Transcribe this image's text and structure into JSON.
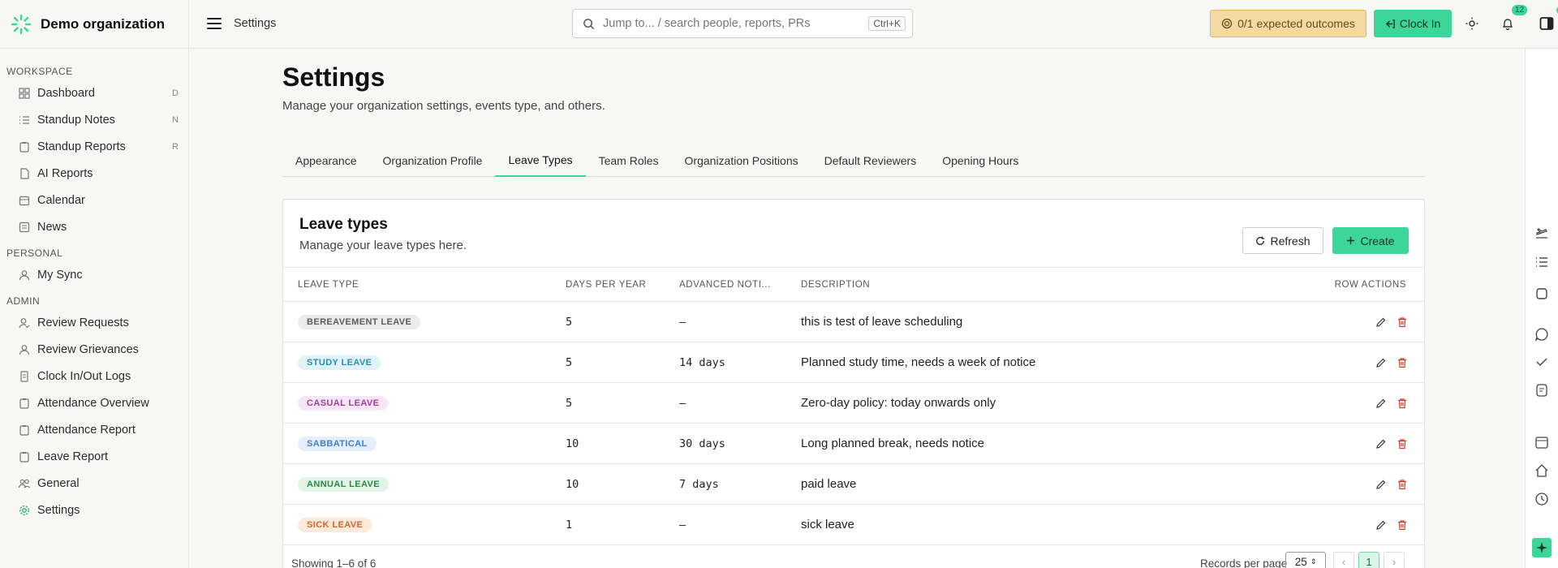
{
  "app": {
    "org_name": "Demo organization",
    "breadcrumb": "Settings"
  },
  "search": {
    "placeholder": "Jump to... / search people, reports, PRs",
    "shortcut": "Ctrl+K"
  },
  "topbar": {
    "outcomes_label": "0/1 expected outcomes",
    "clockin_label": "Clock In",
    "notification_count": "12"
  },
  "sidebar": {
    "sections": [
      {
        "title": "WORKSPACE",
        "items": [
          {
            "label": "Dashboard",
            "shortcut": "D",
            "icon": "grid-icon"
          },
          {
            "label": "Standup Notes",
            "shortcut": "N",
            "icon": "list-icon"
          },
          {
            "label": "Standup Reports",
            "shortcut": "R",
            "icon": "clipboard-icon"
          },
          {
            "label": "AI Reports",
            "shortcut": "",
            "icon": "file-icon"
          },
          {
            "label": "Calendar",
            "shortcut": "",
            "icon": "calendar-icon"
          },
          {
            "label": "News",
            "shortcut": "",
            "icon": "news-icon"
          }
        ]
      },
      {
        "title": "PERSONAL",
        "items": [
          {
            "label": "My Sync",
            "shortcut": "",
            "icon": "user-icon"
          }
        ]
      },
      {
        "title": "ADMIN",
        "items": [
          {
            "label": "Review Requests",
            "shortcut": "",
            "icon": "user-check-icon"
          },
          {
            "label": "Review Grievances",
            "shortcut": "",
            "icon": "user-icon"
          },
          {
            "label": "Clock In/Out Logs",
            "shortcut": "",
            "icon": "log-icon"
          },
          {
            "label": "Attendance Overview",
            "shortcut": "",
            "icon": "clipboard-icon"
          },
          {
            "label": "Attendance Report",
            "shortcut": "",
            "icon": "clipboard-icon"
          },
          {
            "label": "Leave Report",
            "shortcut": "",
            "icon": "clipboard-icon"
          },
          {
            "label": "General",
            "shortcut": "",
            "icon": "users-icon"
          },
          {
            "label": "Settings",
            "shortcut": "",
            "icon": "gear-icon",
            "active": true
          }
        ]
      }
    ]
  },
  "page": {
    "title": "Settings",
    "subtitle": "Manage your organization settings, events type, and others."
  },
  "tabs": [
    {
      "label": "Appearance"
    },
    {
      "label": "Organization Profile"
    },
    {
      "label": "Leave Types",
      "active": true
    },
    {
      "label": "Team Roles"
    },
    {
      "label": "Organization Positions"
    },
    {
      "label": "Default Reviewers"
    },
    {
      "label": "Opening Hours"
    }
  ],
  "card": {
    "title": "Leave types",
    "subtitle": "Manage your leave types here.",
    "refresh_label": "Refresh",
    "create_label": "Create",
    "columns": [
      "LEAVE TYPE",
      "DAYS PER YEAR",
      "ADVANCED NOTI...",
      "DESCRIPTION",
      "ROW ACTIONS"
    ],
    "rows": [
      {
        "type": "BEREAVEMENT LEAVE",
        "color": "#5b5b5b",
        "bg": "#ececea",
        "days": "5",
        "notice": "—",
        "description": "this is test of leave scheduling"
      },
      {
        "type": "STUDY LEAVE",
        "color": "#2a8fb0",
        "bg": "#e0f3f8",
        "days": "5",
        "notice": "14 days",
        "description": "Planned study time, needs a week of notice"
      },
      {
        "type": "CASUAL LEAVE",
        "color": "#a03fa0",
        "bg": "#f7e6f6",
        "days": "5",
        "notice": "—",
        "description": "Zero-day policy: today onwards only"
      },
      {
        "type": "SABBATICAL",
        "color": "#3f7fcf",
        "bg": "#e5eefb",
        "days": "10",
        "notice": "30 days",
        "description": "Long planned break, needs notice"
      },
      {
        "type": "ANNUAL LEAVE",
        "color": "#2a8a45",
        "bg": "#e2f4e6",
        "days": "10",
        "notice": "7 days",
        "description": "paid leave"
      },
      {
        "type": "SICK LEAVE",
        "color": "#d7652a",
        "bg": "#fdeadb",
        "days": "1",
        "notice": "—",
        "description": "sick leave"
      }
    ],
    "showing": "Showing 1–6 of 6",
    "records_per_page_label": "Records per page",
    "records_per_page": "25",
    "current_page": "1"
  },
  "colors": {
    "accent": "#3dd598",
    "outcomes_bg": "#f5d9a3"
  }
}
